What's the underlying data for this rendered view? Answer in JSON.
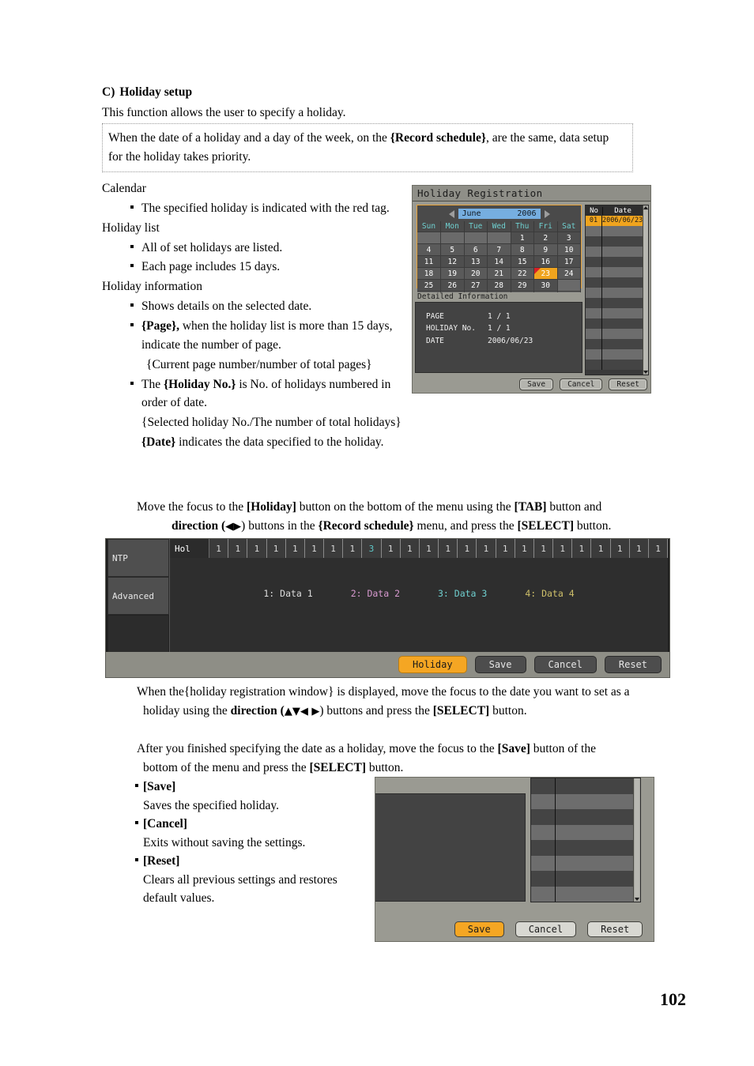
{
  "document": {
    "section_letter": "C)",
    "section_title": "Holiday setup",
    "intro": "This function allows the user to specify a holiday.",
    "note_part1": "When the date of a holiday and a day of the week, on the ",
    "note_bold": "{Record schedule}",
    "note_part2": ", are the same, data setup for the holiday takes priority.",
    "page_number": "102"
  },
  "left_list": {
    "calendar_label": "Calendar",
    "calendar_bullet": "The specified holiday is indicated with the red tag.",
    "holiday_list_label": "Holiday list",
    "holiday_list_bullet1": "All of set holidays are listed.",
    "holiday_list_bullet2": "Each page includes 15 days.",
    "holiday_info_label": "Holiday information",
    "info_bullet1": "Shows details on the selected date.",
    "info_bullet2_bold": "{Page},",
    "info_bullet2_rest": " when the holiday list is more than 15 days, indicate the number of page.",
    "info_bullet2_sub": "{Current page number/number of total pages}",
    "info_bullet3_pre": "The ",
    "info_bullet3_bold": "{Holiday No.}",
    "info_bullet3_rest": " is No. of holidays numbered in order of date.",
    "info_bullet3_sub": "{Selected holiday No./The number of total holidays}",
    "info_bullet4_bold": "{Date}",
    "info_bullet4_rest": " indicates the data specified to the holiday."
  },
  "paragraphs": {
    "p1_line1_a": "Move the focus to the ",
    "p1_holiday": "[Holiday]",
    "p1_line1_b": " button on the bottom of the menu using the ",
    "p1_tab": "[TAB]",
    "p1_line1_c": " button and",
    "p1_direction": "direction (",
    "p1_dir_arrows": "◀▶",
    "p1_line2_a": ") buttons in the ",
    "p1_record": "{Record schedule}",
    "p1_line2_b": " menu, and press the ",
    "p1_select": "[SELECT]",
    "p1_line2_c": " button.",
    "p2_line1": "When the{holiday registration window} is displayed, move the focus to the date you want to set as a",
    "p2_line2_a": "holiday using the ",
    "p2_direction": "direction (",
    "p2_dir_arrows": "▲▼◀ ▶",
    "p2_line2_b": ") buttons and press the ",
    "p2_select": "[SELECT]",
    "p2_line2_c": " button.",
    "p3_line1_a": "After you finished specifying the date as a holiday, move the focus to the ",
    "p3_save": "[Save]",
    "p3_line1_b": " button of the",
    "p3_line2_a": "bottom of the menu and press the ",
    "p3_select": "[SELECT]",
    "p3_line2_b": " button."
  },
  "button_descriptions": [
    {
      "label": "[Save]",
      "desc": "Saves the specified holiday."
    },
    {
      "label": "[Cancel]",
      "desc": "Exits without saving the settings."
    },
    {
      "label": "[Reset]",
      "desc": "Clears all previous settings and restores default values."
    }
  ],
  "holiday_dialog": {
    "title": "Holiday Registration",
    "prev_arrow_icon": "left-triangle-icon",
    "next_arrow_icon": "right-triangle-icon",
    "month": "June",
    "year": "2006",
    "weekday_headers": [
      "Sun",
      "Mon",
      "Tue",
      "Wed",
      "Thu",
      "Fri",
      "Sat"
    ],
    "calendar_weeks": [
      [
        "",
        "",
        "",
        "",
        "1",
        "2",
        "3"
      ],
      [
        "4",
        "5",
        "6",
        "7",
        "8",
        "9",
        "10"
      ],
      [
        "11",
        "12",
        "13",
        "14",
        "15",
        "16",
        "17"
      ],
      [
        "18",
        "19",
        "20",
        "21",
        "22",
        "23",
        "24"
      ],
      [
        "25",
        "26",
        "27",
        "28",
        "29",
        "30",
        ""
      ]
    ],
    "selected_day": "23",
    "detail_tab_label": "Detailed Information",
    "detail_rows": [
      {
        "key": "PAGE",
        "value": "1 / 1"
      },
      {
        "key": "HOLIDAY No.",
        "value": "1 / 1"
      },
      {
        "key": "DATE",
        "value": "2006/06/23"
      }
    ],
    "list_headers": {
      "no": "No",
      "date": "Date"
    },
    "list_rows": [
      {
        "no": "01",
        "date": "2006/06/23",
        "selected": true
      },
      {
        "no": "",
        "date": "",
        "selected": false
      },
      {
        "no": "",
        "date": "",
        "selected": false
      },
      {
        "no": "",
        "date": "",
        "selected": false
      },
      {
        "no": "",
        "date": "",
        "selected": false
      },
      {
        "no": "",
        "date": "",
        "selected": false
      },
      {
        "no": "",
        "date": "",
        "selected": false
      },
      {
        "no": "",
        "date": "",
        "selected": false
      },
      {
        "no": "",
        "date": "",
        "selected": false
      },
      {
        "no": "",
        "date": "",
        "selected": false
      },
      {
        "no": "",
        "date": "",
        "selected": false
      },
      {
        "no": "",
        "date": "",
        "selected": false
      },
      {
        "no": "",
        "date": "",
        "selected": false
      },
      {
        "no": "",
        "date": "",
        "selected": false
      },
      {
        "no": "",
        "date": "",
        "selected": false
      }
    ],
    "scroll_up_icon": "scroll-up-arrow-icon",
    "scroll_down_icon": "scroll-down-arrow-icon",
    "buttons": {
      "save": "Save",
      "cancel": "Cancel",
      "reset": "Reset"
    },
    "colors": {
      "accent": "#f0a41e",
      "red_tag": "#d81f26",
      "month_field": "#76aee0"
    }
  },
  "schedule_panel": {
    "tabs": [
      {
        "label": "NTP"
      },
      {
        "label": "Advanced"
      }
    ],
    "hol_label": "Hol",
    "hol_cells": [
      "1",
      "1",
      "1",
      "1",
      "1",
      "1",
      "1",
      "1",
      "3",
      "1",
      "1",
      "1",
      "1",
      "1",
      "1",
      "1",
      "1",
      "1",
      "1",
      "1",
      "1",
      "1",
      "1",
      "1"
    ],
    "highlight_index": 8,
    "legend": [
      {
        "label": "1: Data 1",
        "color": "#dcdcdc"
      },
      {
        "label": "2: Data 2",
        "color": "#d89ad0"
      },
      {
        "label": "3: Data 3",
        "color": "#6fcfcf"
      },
      {
        "label": "4: Data 4",
        "color": "#cfc06a"
      }
    ],
    "buttons": {
      "holiday": "Holiday",
      "save": "Save",
      "cancel": "Cancel",
      "reset": "Reset"
    }
  },
  "save_dialog": {
    "buttons": {
      "save": "Save",
      "cancel": "Cancel",
      "reset": "Reset"
    },
    "scroll_down_icon": "scroll-down-arrow-icon"
  }
}
